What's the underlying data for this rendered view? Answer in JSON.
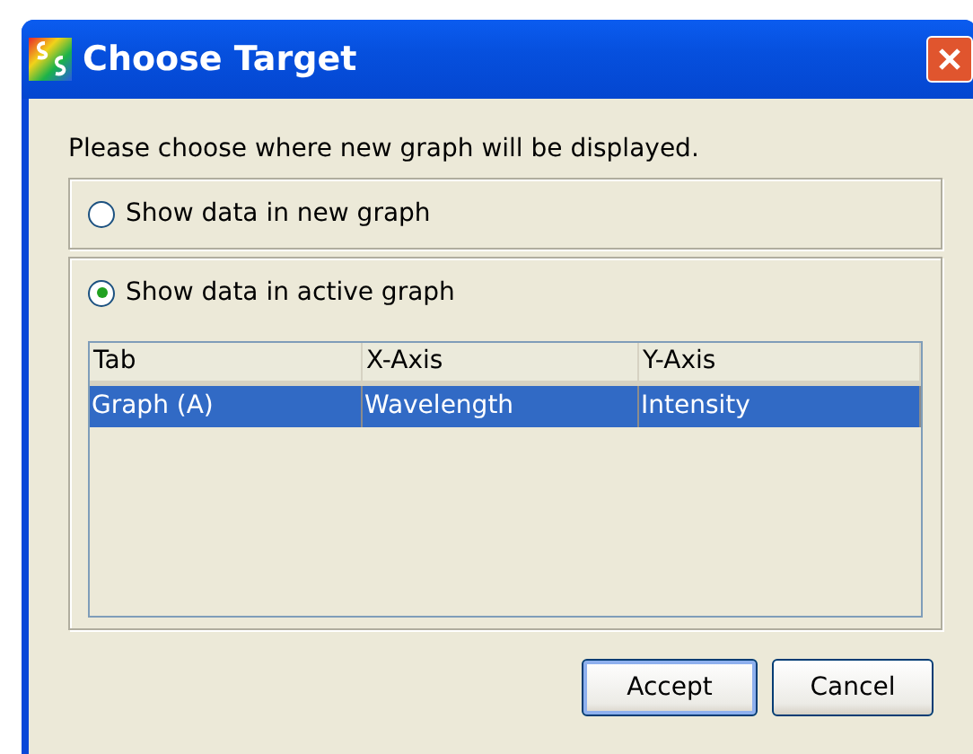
{
  "window": {
    "title": "Choose Target"
  },
  "prompt": "Please choose where new graph will be displayed.",
  "options": [
    {
      "label": "Show data in new graph",
      "selected": false
    },
    {
      "label": "Show data in active graph",
      "selected": true
    }
  ],
  "table": {
    "columns": [
      "Tab",
      "X-Axis",
      "Y-Axis"
    ],
    "rows": [
      {
        "cells": [
          "Graph (A)",
          "Wavelength",
          "Intensity"
        ],
        "selected": true
      }
    ]
  },
  "buttons": [
    {
      "label": "Accept",
      "default": true
    },
    {
      "label": "Cancel",
      "default": false
    }
  ]
}
